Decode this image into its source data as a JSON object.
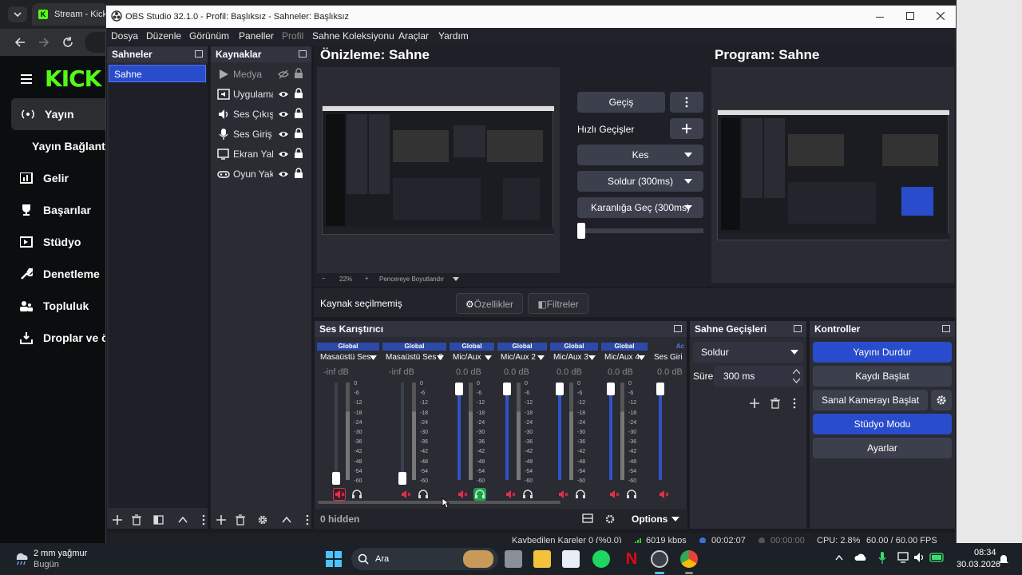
{
  "browser": {
    "tab_title": "Stream - Kick D",
    "kick_logo": "KICK",
    "sidebar": [
      {
        "label": "Yayın",
        "icon": "broadcast-icon"
      },
      {
        "label": "Yayın Bağlantı"
      },
      {
        "label": "Gelir",
        "icon": "chart-icon"
      },
      {
        "label": "Başarılar",
        "icon": "trophy-icon"
      },
      {
        "label": "Stüdyo",
        "icon": "studio-icon"
      },
      {
        "label": "Denetleme",
        "icon": "wrench-icon"
      },
      {
        "label": "Topluluk",
        "icon": "community-icon"
      },
      {
        "label": "Droplar ve ö",
        "icon": "drops-icon"
      }
    ]
  },
  "obs": {
    "title": "OBS Studio 32.1.0 - Profil: Başlıksız - Sahneler: Başlıksız",
    "menus": [
      "Dosya",
      "Düzenle",
      "Görünüm",
      "Paneller",
      "Profil",
      "Sahne Koleksiyonu",
      "Araçlar",
      "Yardım"
    ],
    "scenes": {
      "header": "Sahneler",
      "items": [
        "Sahne"
      ]
    },
    "sources": {
      "header": "Kaynaklar",
      "items": [
        {
          "label": "Medya",
          "icon": "play-icon"
        },
        {
          "label": "Uygulama",
          "icon": "app-audio-icon"
        },
        {
          "label": "Ses Çıkış Y",
          "icon": "speaker-icon"
        },
        {
          "label": "Ses Giriş Y",
          "icon": "microphone-icon"
        },
        {
          "label": "Ekran Yak",
          "icon": "monitor-icon"
        },
        {
          "label": "Oyun Yak",
          "icon": "gamepad-icon"
        }
      ]
    },
    "preview_title": "Önizleme: Sahne",
    "program_title": "Program: Sahne",
    "zoom": "22%",
    "zoom_mode": "Pencereye Boyutlandır",
    "transitions": {
      "gecis": "Geçiş",
      "quick": "Hızlı Geçişler",
      "items": [
        "Kes",
        "Soldur (300ms)",
        "Karanlığa Geç (300ms)"
      ]
    },
    "no_source": "Kaynak seçilmemiş",
    "properties": "Özellikler",
    "filters": "Filtreler",
    "mixer": {
      "header": "Ses Karıştırıcı",
      "channels": [
        {
          "global": "Global",
          "name": "Masaüstü Ses",
          "db": "-inf dB",
          "level": 0,
          "state": "muted"
        },
        {
          "global": "Global",
          "name": "Masaüstü Ses 2",
          "db": "-inf dB",
          "level": 0,
          "state": "normal"
        },
        {
          "global": "Global",
          "name": "Mic/Aux",
          "db": "0.0 dB",
          "level": 1,
          "state": "monitor"
        },
        {
          "global": "Global",
          "name": "Mic/Aux 2",
          "db": "0.0 dB",
          "level": 1,
          "state": "normal"
        },
        {
          "global": "Global",
          "name": "Mic/Aux 3",
          "db": "0.0 dB",
          "level": 1,
          "state": "normal"
        },
        {
          "global": "Global",
          "name": "Mic/Aux 4",
          "db": "0.0 dB",
          "level": 1,
          "state": "normal"
        },
        {
          "global": "Ac",
          "name": "Ses Giri",
          "db": "0.0 dB",
          "level": 1,
          "state": "normal"
        }
      ],
      "scale": [
        "0",
        "-6",
        "-12",
        "-18",
        "-24",
        "-30",
        "-36",
        "-42",
        "-48",
        "-54",
        "-60"
      ],
      "hidden": "0 hidden",
      "options": "Options"
    },
    "scene_transitions": {
      "header": "Sahne Geçişleri",
      "select": "Soldur",
      "duration_label": "Süre",
      "duration": "300 ms"
    },
    "controls": {
      "header": "Kontroller",
      "buttons": [
        "Yayını Durdur",
        "Kaydı Başlat",
        "Sanal Kamerayı Başlat",
        "Stüdyo Modu",
        "Ayarlar"
      ]
    },
    "status": {
      "dropped": "Kaybedilen Kareler 0 (%0.0)",
      "bitrate": "6019 kbps",
      "stream_time": "00:02:07",
      "rec_time": "00:00:00",
      "cpu": "CPU: 2.8%",
      "fps": "60.00 / 60.00 FPS"
    }
  },
  "taskbar": {
    "weather": "2 mm yağmur",
    "weather_sub": "Bugün",
    "search": "Ara",
    "time": "08:34",
    "date": "30.03.2026"
  },
  "colors": {
    "accent": "#284ccb",
    "kick_green": "#53fc18",
    "meter_blue": "#2f54c8",
    "muted_red": "#e0304a",
    "monitor_green": "#1aa34a"
  }
}
